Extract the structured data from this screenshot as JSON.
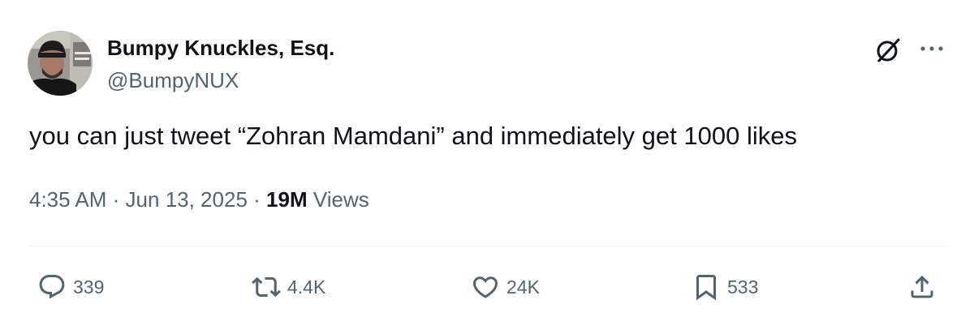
{
  "author": {
    "display_name": "Bumpy Knuckles, Esq.",
    "handle": "@BumpyNUX",
    "avatar_icon": "profile-photo"
  },
  "header_icons": {
    "grok": "grok-icon",
    "more": "more-icon"
  },
  "tweet": {
    "text": "you can just tweet “Zohran Mamdani” and immediately get 1000 likes",
    "time": "4:35 AM",
    "separator": "·",
    "date": "Jun 13, 2025",
    "views_count": "19M",
    "views_label": "Views"
  },
  "actions": {
    "replies": "339",
    "retweets": "4.4K",
    "likes": "24K",
    "bookmarks": "533"
  },
  "colors": {
    "text_primary": "#0f1419",
    "text_secondary": "#536471",
    "divider": "#eff3f4"
  }
}
